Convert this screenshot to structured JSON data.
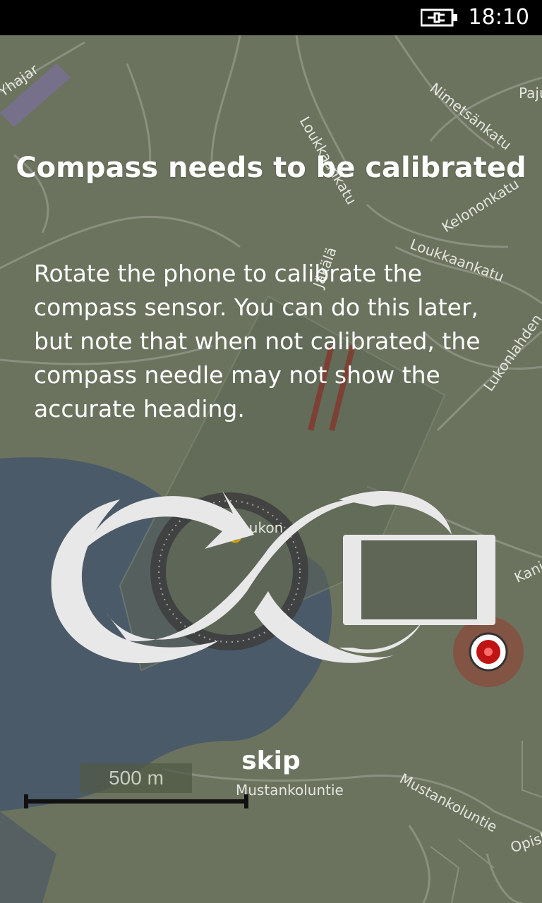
{
  "status_bar": {
    "time": "18:10"
  },
  "map": {
    "street_labels": [
      "Yhajar",
      "Loukkaankatu",
      "Nimetsänkatu",
      "Paju",
      "Kelononkatu",
      "Loukkaankatu",
      "Lukonlahden",
      "Jäkälä",
      "Lukon",
      "Kanjo",
      "Mustankoluntie",
      "Mustankoluntie",
      "Opisk"
    ],
    "scale": {
      "label": "500 m"
    }
  },
  "dialog": {
    "title": "Compass needs to be calibrated",
    "message": "Rotate the phone to calibrate the compass sensor. You can do this later, but note that when not calibrated, the compass needle may not show the accurate heading.",
    "skip_label": "skip"
  },
  "colors": {
    "map_bg": "#6b735e",
    "water": "#4b5a68",
    "overlay_text": "#ffffff",
    "status_bar": "#000000",
    "graphic": "#e8e8e8"
  }
}
